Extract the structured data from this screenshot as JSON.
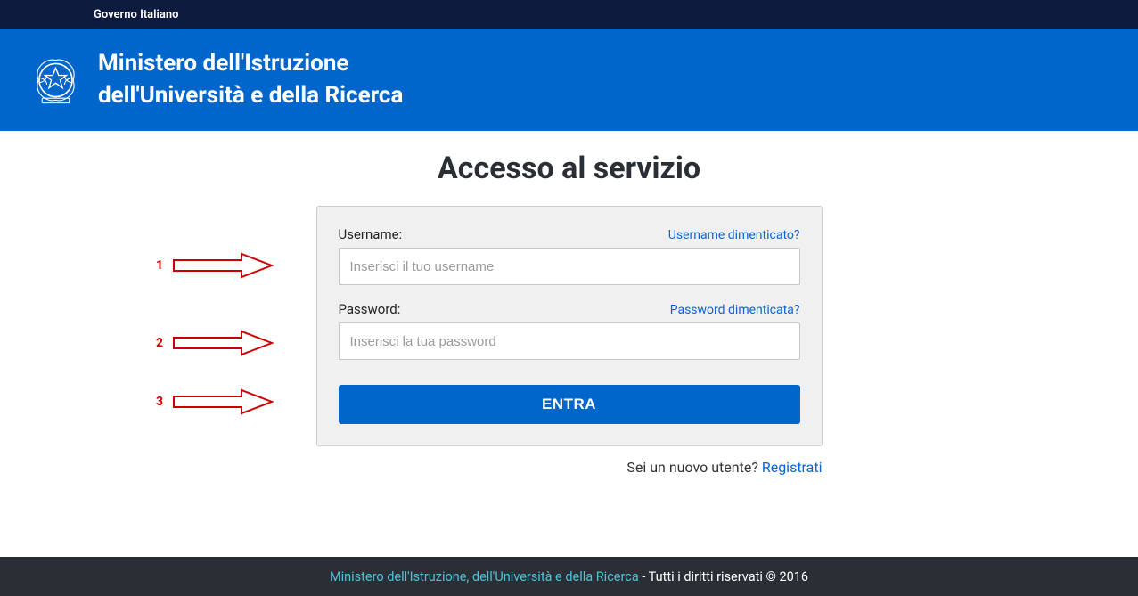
{
  "topbar": {
    "gov_label": "Governo Italiano"
  },
  "header": {
    "title_line1": "Ministero dell'Istruzione",
    "title_line2": "dell'Università e della Ricerca"
  },
  "page": {
    "title": "Accesso al servizio"
  },
  "form": {
    "username": {
      "label": "Username:",
      "placeholder": "Inserisci il tuo username",
      "forgot": "Username dimenticato?"
    },
    "password": {
      "label": "Password:",
      "placeholder": "Inserisci la tua password",
      "forgot": "Password dimenticata?"
    },
    "submit": "ENTRA"
  },
  "register": {
    "prompt": "Sei un nuovo utente? ",
    "link": "Registrati"
  },
  "footer": {
    "link": "Ministero dell'Istruzione, dell'Università e della Ricerca",
    "rights": " - Tutti i diritti riservati © 2016"
  },
  "annotations": {
    "a1": "1",
    "a2": "2",
    "a3": "3"
  }
}
